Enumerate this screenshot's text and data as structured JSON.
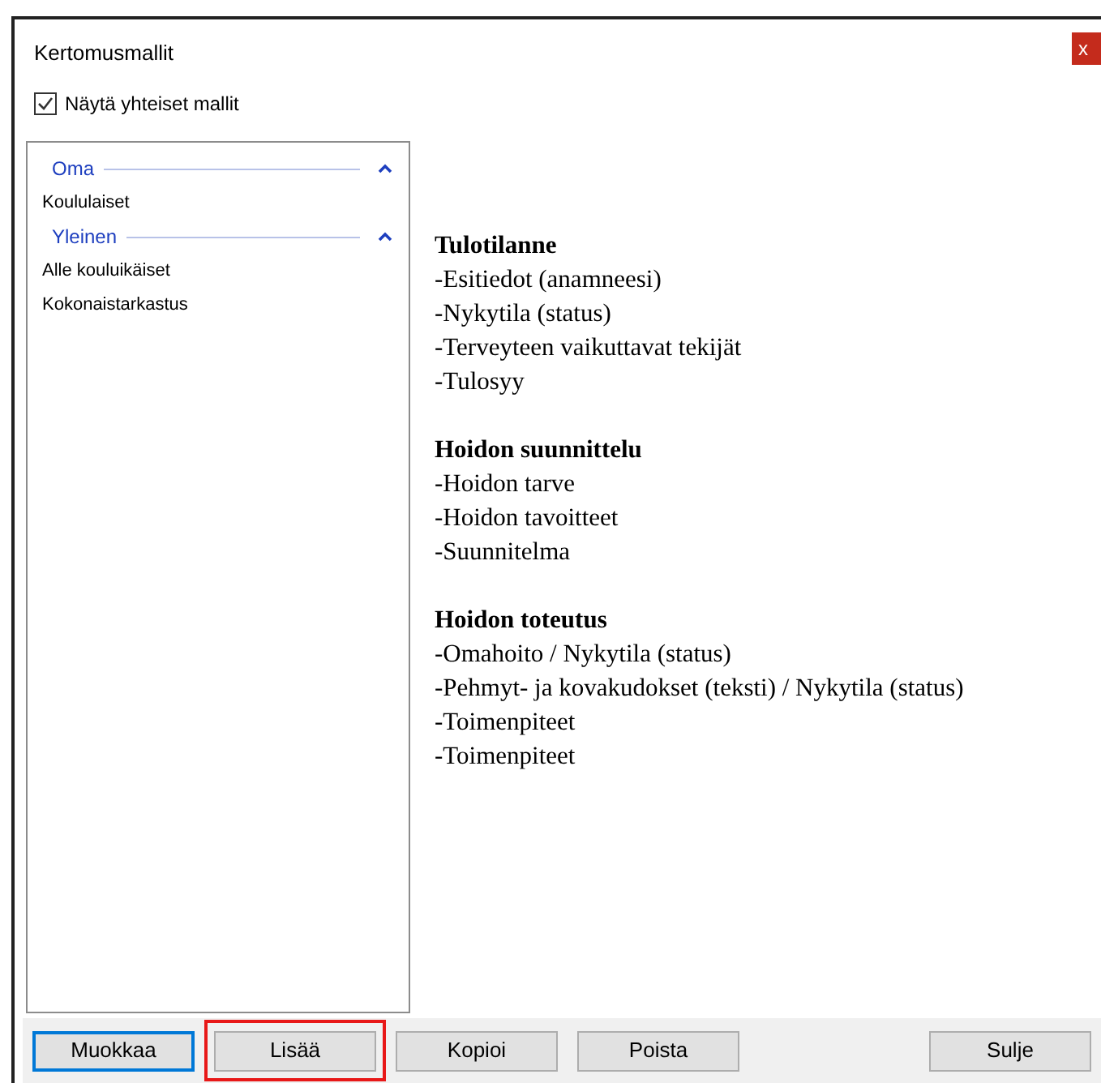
{
  "window": {
    "title": "Kertomusmallit",
    "close": "x"
  },
  "show_shared": {
    "label": "Näytä yhteiset mallit",
    "checked": true
  },
  "template_groups": [
    {
      "title": "Oma",
      "expanded": true,
      "items": [
        "Koululaiset"
      ]
    },
    {
      "title": "Yleinen",
      "expanded": true,
      "items": [
        "Alle kouluikäiset",
        "Kokonaistarkastus"
      ]
    }
  ],
  "preview": [
    {
      "heading": "Tulotilanne",
      "lines": [
        "-Esitiedot (anamneesi)",
        "-Nykytila (status)",
        "-Terveyteen vaikuttavat tekijät",
        "-Tulosyy"
      ]
    },
    {
      "heading": "Hoidon suunnittelu",
      "lines": [
        "-Hoidon tarve",
        "-Hoidon tavoitteet",
        "-Suunnitelma"
      ]
    },
    {
      "heading": "Hoidon toteutus",
      "lines": [
        "-Omahoito / Nykytila (status)",
        "-Pehmyt- ja kovakudokset (teksti) / Nykytila (status)",
        "-Toimenpiteet",
        "-Toimenpiteet"
      ]
    }
  ],
  "buttons": [
    {
      "label": "Muokkaa",
      "focused": true,
      "highlighted": false
    },
    {
      "label": "Lisää",
      "focused": false,
      "highlighted": true
    },
    {
      "label": "Kopioi",
      "focused": false,
      "highlighted": false
    },
    {
      "label": "Poista",
      "focused": false,
      "highlighted": false
    },
    {
      "label": "Sulje",
      "focused": false,
      "highlighted": false
    }
  ]
}
